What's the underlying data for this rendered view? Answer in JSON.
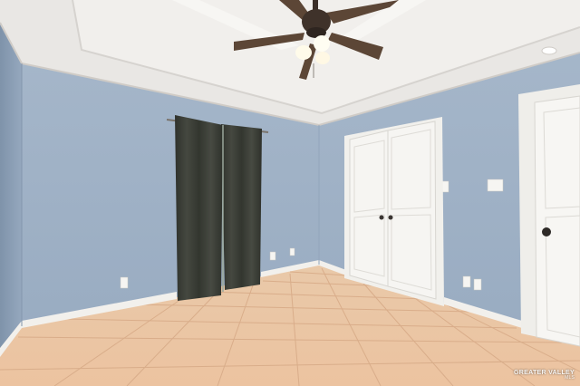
{
  "watermark": {
    "line1": "GREATER VALLEY",
    "line2": "MLS"
  },
  "colors": {
    "wall": "#9fb1c6",
    "wall_left": "#8fa3ba",
    "ceiling": "#eeecea",
    "trim": "#f4f3ef",
    "floor_tile": "#e7c3a2",
    "curtain": "#3a3d36",
    "door": "#f3f2ef"
  }
}
